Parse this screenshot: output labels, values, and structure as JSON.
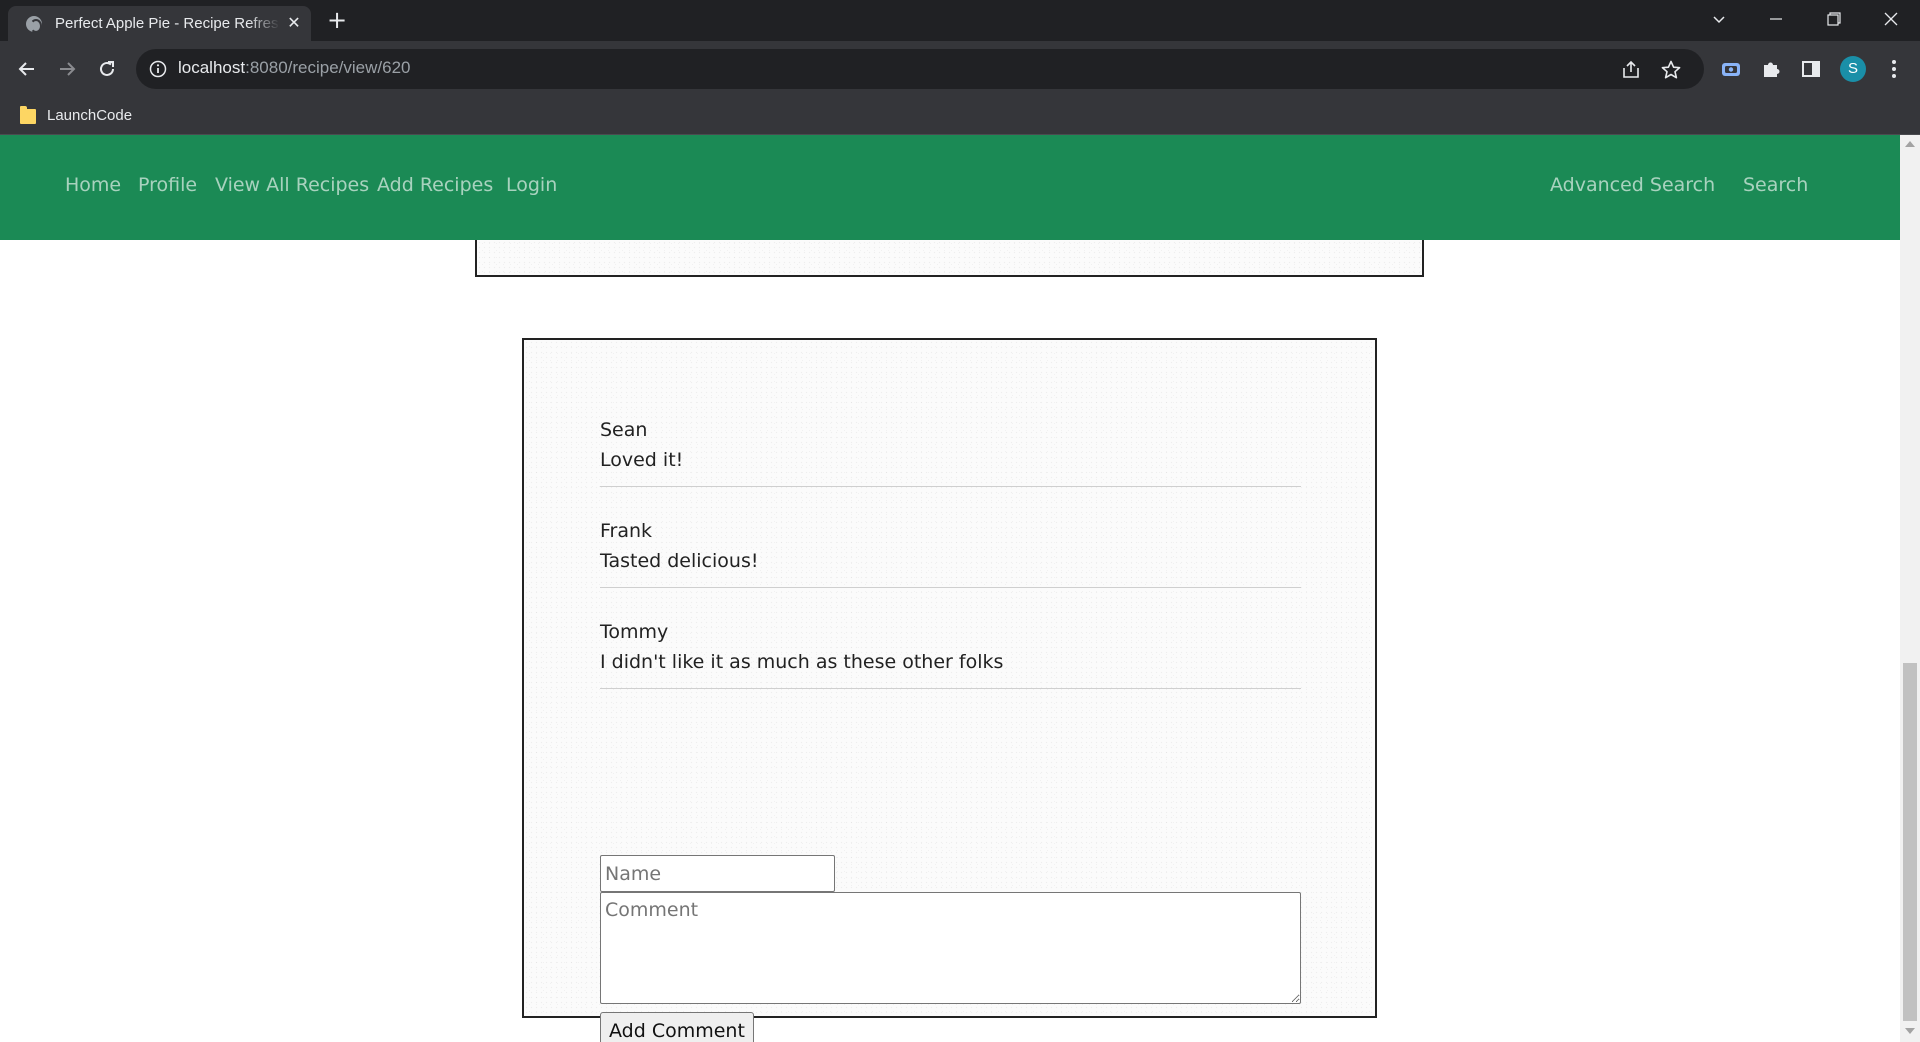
{
  "browser": {
    "tab_title": "Perfect Apple Pie - Recipe Refresh",
    "url_host": "localhost",
    "url_path": ":8080/recipe/view/620",
    "profile_initial": "S",
    "bookmark_label": "LaunchCode",
    "icons": [
      "close-icon",
      "plus-icon",
      "back-icon",
      "forward-icon",
      "reload-icon",
      "info-icon",
      "share-icon",
      "star-icon",
      "extension-icon",
      "puzzle-icon",
      "side-panel-icon",
      "more-icon"
    ]
  },
  "nav": {
    "links": [
      "Home",
      "Profile",
      "View All Recipes",
      "Add Recipes",
      "Login"
    ],
    "right": [
      "Advanced Search",
      "Search"
    ],
    "color": "#1b8a55"
  },
  "comments": [
    {
      "name": "Sean",
      "text": "Loved it!"
    },
    {
      "name": "Frank",
      "text": "Tasted delicious!"
    },
    {
      "name": "Tommy",
      "text": "I didn't like it as much as these other folks"
    }
  ],
  "form": {
    "name_placeholder": "Name",
    "comment_placeholder": "Comment",
    "submit_label": "Add Comment"
  }
}
